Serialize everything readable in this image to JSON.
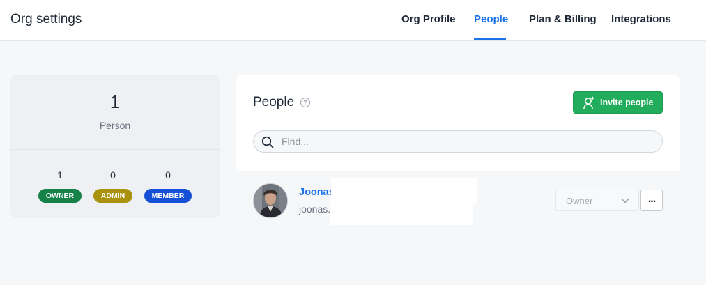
{
  "header": {
    "title": "Org settings",
    "tabs": [
      {
        "label": "Org Profile",
        "active": false
      },
      {
        "label": "People",
        "active": true
      },
      {
        "label": "Plan & Billing",
        "active": false
      },
      {
        "label": "Integrations",
        "active": false
      }
    ],
    "accent_color": "#1a73e8"
  },
  "stats": {
    "total_count": "1",
    "total_label": "Person",
    "roles": [
      {
        "count": "1",
        "label": "OWNER",
        "color": "#16824a"
      },
      {
        "count": "0",
        "label": "ADMIN",
        "color": "#a8920e"
      },
      {
        "count": "0",
        "label": "MEMBER",
        "color": "#1550d6"
      }
    ]
  },
  "people": {
    "heading": "People",
    "help_icon": "question-circle-icon",
    "invite_label": "Invite people",
    "invite_icon": "add-user-icon",
    "invite_color": "#22ad5c",
    "search_placeholder": "Find...",
    "search_icon": "search-icon"
  },
  "members": [
    {
      "name": "Joonas",
      "email": "joonas.",
      "role": "Owner",
      "actions_label": "..."
    }
  ]
}
